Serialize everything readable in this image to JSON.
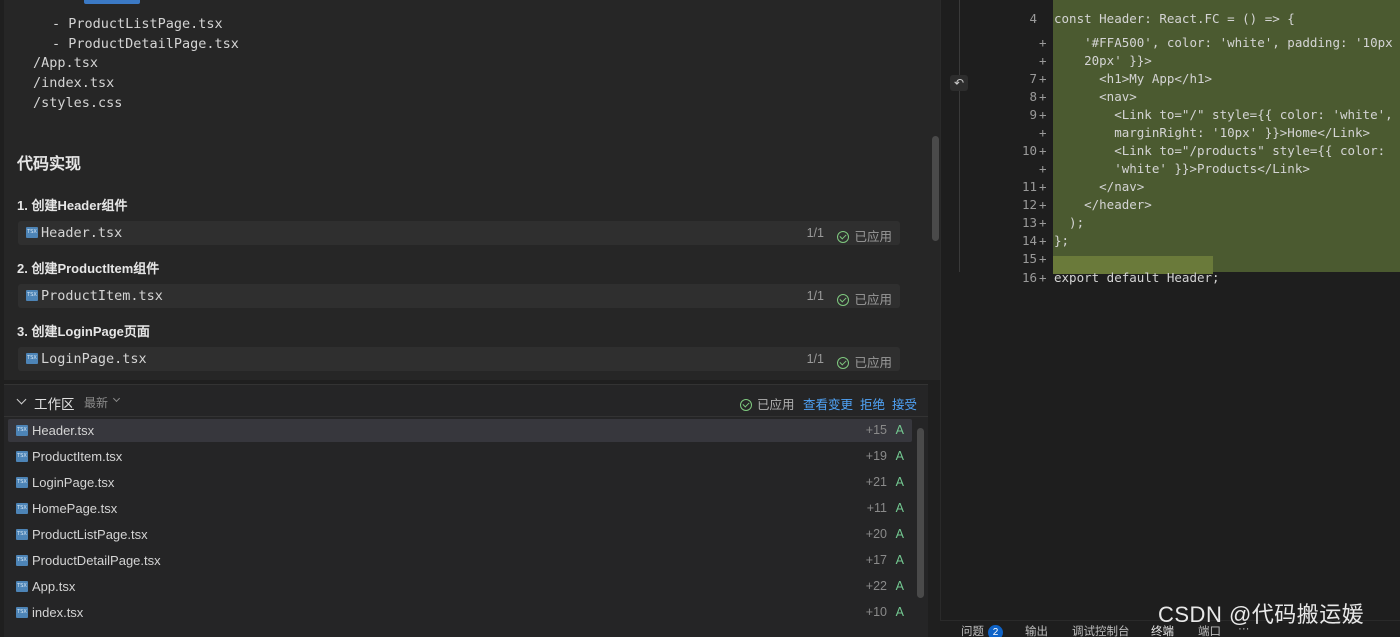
{
  "chat": {
    "tree": [
      "- ProductListPage.tsx",
      "- ProductDetailPage.tsx",
      "/App.tsx",
      "/index.tsx",
      "/styles.css"
    ],
    "heading": "代码实现",
    "steps": [
      {
        "title": "1. 创建Header组件",
        "file": "Header.tsx",
        "count": "1/1",
        "status": "已应用"
      },
      {
        "title": "2. 创建ProductItem组件",
        "file": "ProductItem.tsx",
        "count": "1/1",
        "status": "已应用"
      },
      {
        "title": "3. 创建LoginPage页面",
        "file": "LoginPage.tsx",
        "count": "1/1",
        "status": "已应用"
      }
    ]
  },
  "workspace": {
    "title": "工作区",
    "sort": "最新",
    "status": "已应用",
    "actions": {
      "view_changes": "查看变更",
      "reject": "拒绝",
      "accept": "接受"
    },
    "files": [
      {
        "name": "Header.tsx",
        "added": "+15",
        "flag": "A"
      },
      {
        "name": "ProductItem.tsx",
        "added": "+19",
        "flag": "A"
      },
      {
        "name": "LoginPage.tsx",
        "added": "+21",
        "flag": "A"
      },
      {
        "name": "HomePage.tsx",
        "added": "+11",
        "flag": "A"
      },
      {
        "name": "ProductListPage.tsx",
        "added": "+20",
        "flag": "A"
      },
      {
        "name": "ProductDetailPage.tsx",
        "added": "+17",
        "flag": "A"
      },
      {
        "name": "App.tsx",
        "added": "+22",
        "flag": "A"
      },
      {
        "name": "index.tsx",
        "added": "+10",
        "flag": "A"
      }
    ]
  },
  "editor": {
    "lines": [
      {
        "ln": "4",
        "plus": "",
        "code": "const Header: React.FC = () => {"
      },
      {
        "ln": "",
        "plus": "+",
        "code": "    '#FFA500', color: 'white', padding: '10px"
      },
      {
        "ln": "",
        "plus": "+",
        "code": "    20px' }}>"
      },
      {
        "ln": "7",
        "plus": "+",
        "code": "      <h1>My App</h1>"
      },
      {
        "ln": "8",
        "plus": "+",
        "code": "      <nav>"
      },
      {
        "ln": "9",
        "plus": "+",
        "code": "        <Link to=\"/\" style={{ color: 'white',"
      },
      {
        "ln": "",
        "plus": "+",
        "code": "        marginRight: '10px' }}>Home</Link>"
      },
      {
        "ln": "10",
        "plus": "+",
        "code": "        <Link to=\"/products\" style={{ color:"
      },
      {
        "ln": "",
        "plus": "+",
        "code": "        'white' }}>Products</Link>"
      },
      {
        "ln": "11",
        "plus": "+",
        "code": "      </nav>"
      },
      {
        "ln": "12",
        "plus": "+",
        "code": "    </header>"
      },
      {
        "ln": "13",
        "plus": "+",
        "code": "  );"
      },
      {
        "ln": "14",
        "plus": "+",
        "code": "};"
      },
      {
        "ln": "15",
        "plus": "+",
        "code": ""
      },
      {
        "ln": "16",
        "plus": "+",
        "code": "export default Header;"
      }
    ]
  },
  "panel_tabs": {
    "problems": "问题",
    "problems_count": "2",
    "output": "输出",
    "debug_console": "调试控制台",
    "terminal": "终端",
    "ports": "端口",
    "more": "···"
  },
  "watermark": "CSDN @代码搬运媛"
}
